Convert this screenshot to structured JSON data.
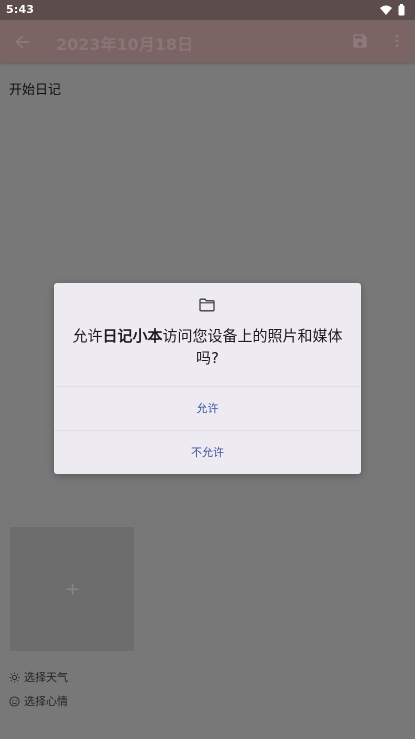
{
  "status_bar": {
    "time": "5:43"
  },
  "app_bar": {
    "title": "2023年10月18日"
  },
  "content": {
    "start_text": "开始日记",
    "image_add_symbol": "+",
    "weather_label": "选择天气",
    "mood_label": "选择心情"
  },
  "dialog": {
    "msg_prefix": "允许",
    "app_name": "日记小本",
    "msg_suffix": "访问您设备上的照片和媒体吗?",
    "allow_label": "允许",
    "deny_label": "不允许"
  },
  "colors": {
    "scrim": "#787878",
    "dialog_bg": "#eeeaf2",
    "button_text": "#3e55a1"
  },
  "icons": [
    "back-arrow-icon",
    "save-icon",
    "more-vert-icon",
    "folder-icon",
    "sun-icon",
    "smiley-icon",
    "wifi-icon",
    "battery-icon"
  ]
}
